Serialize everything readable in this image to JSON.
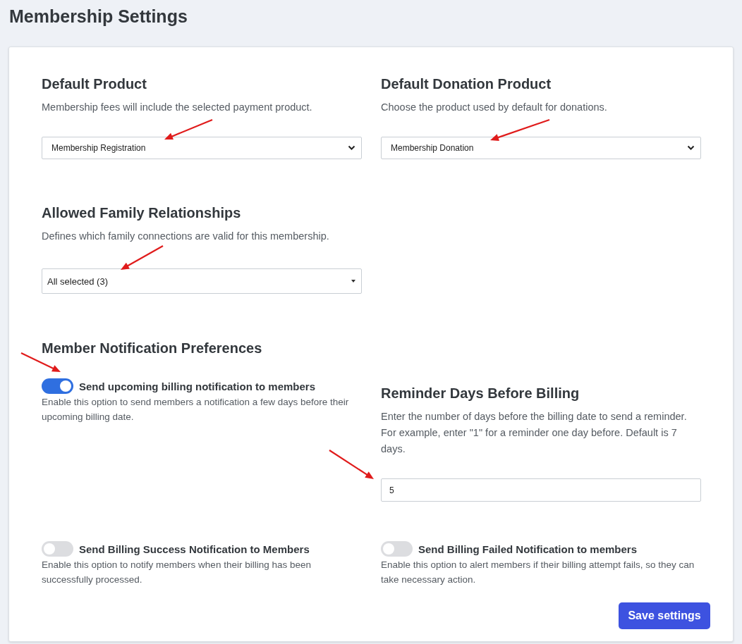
{
  "page_title": "Membership Settings",
  "default_product": {
    "title": "Default Product",
    "description": "Membership fees will include the selected payment product.",
    "value": "Membership Registration",
    "arrow": true
  },
  "default_donation_product": {
    "title": "Default Donation Product",
    "description": "Choose the product used by default for donations.",
    "value": "Membership Donation",
    "arrow": true
  },
  "family_relationships": {
    "title": "Allowed Family Relationships",
    "description": "Defines which family connections are valid for this membership.",
    "value": "All selected (3)",
    "arrow": true
  },
  "notifications": {
    "title": "Member Notification Preferences"
  },
  "toggles": [
    {
      "label": "Send upcoming billing notification to members",
      "description": "Enable this option to send members a notification a few days before their upcoming billing date.",
      "on": true,
      "arrow": true
    },
    {
      "label": "Send Billing Success Notification to Members",
      "description": "Enable this option to notify members when their billing has been successfully processed.",
      "on": false,
      "arrow": false
    },
    {
      "label": "Send Billing Failed Notification to members",
      "description": "Enable this option to alert members if their billing attempt fails, so they can take necessary action.",
      "on": false,
      "arrow": false
    }
  ],
  "reminder_days": {
    "title": "Reminder Days Before Billing",
    "description": "Enter the number of days before the billing date to send a reminder. For example, enter \"1\" for a reminder one day before. Default is 7 days.",
    "value": "5",
    "arrow": true
  },
  "save_button": "Save settings"
}
